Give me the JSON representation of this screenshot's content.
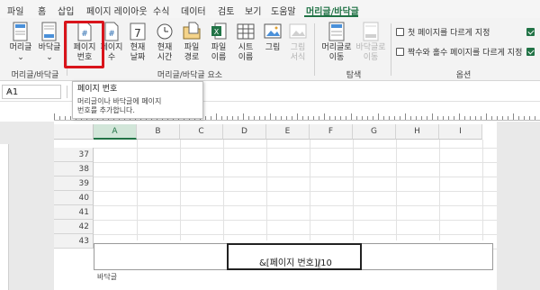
{
  "ribbon_tabs": [
    {
      "label": "파일",
      "active": false
    },
    {
      "label": "홈",
      "active": false
    },
    {
      "label": "삽입",
      "active": false
    },
    {
      "label": "페이지 레이아웃",
      "active": false
    },
    {
      "label": "수식",
      "active": false
    },
    {
      "label": "데이터",
      "active": false
    },
    {
      "label": "검토",
      "active": false
    },
    {
      "label": "보기",
      "active": false
    },
    {
      "label": "도움말",
      "active": false
    },
    {
      "label": "머리글/바닥글",
      "active": true
    }
  ],
  "ribbon": {
    "buttons": {
      "header": "머리글\n⌄",
      "footer": "바닥글\n⌄",
      "page_number": "페이지\n번호",
      "page_count": "페이지\n수",
      "current_date": "현재\n날짜",
      "current_time": "현재\n시간",
      "file_path": "파일\n경로",
      "file_name": "파일\n이름",
      "sheet_name": "시트\n이름",
      "picture": "그림",
      "format_picture": "그림\n서식",
      "goto_header": "머리글로\n이동",
      "goto_footer": "바닥글로\n이동"
    },
    "groups": {
      "header_footer": "머리글/바닥글",
      "elements": "머리글/바닥글 요소",
      "navigation": "탐색",
      "options": "옵션"
    },
    "options": {
      "different_first": "첫 페이지를 다르게 지정",
      "different_odd_even": "짝수와 홀수 페이지를 다르게 지정"
    }
  },
  "name_box": {
    "value": "A1"
  },
  "tooltip": {
    "title": "페이지 번호",
    "description": "머리글이나 바닥글에 페이지\n번호를 추가합니다."
  },
  "columns": [
    "A",
    "B",
    "C",
    "D",
    "E",
    "F",
    "G",
    "H",
    "I"
  ],
  "rows": [
    "37",
    "38",
    "39",
    "40",
    "41",
    "42",
    "43"
  ],
  "footer": {
    "code_main": "&[페이지 번호]",
    "code_sel": "/",
    "code_tail": "10",
    "label": "바닥글"
  },
  "colors": {
    "accent": "#217346",
    "highlight": "#d9141b"
  }
}
